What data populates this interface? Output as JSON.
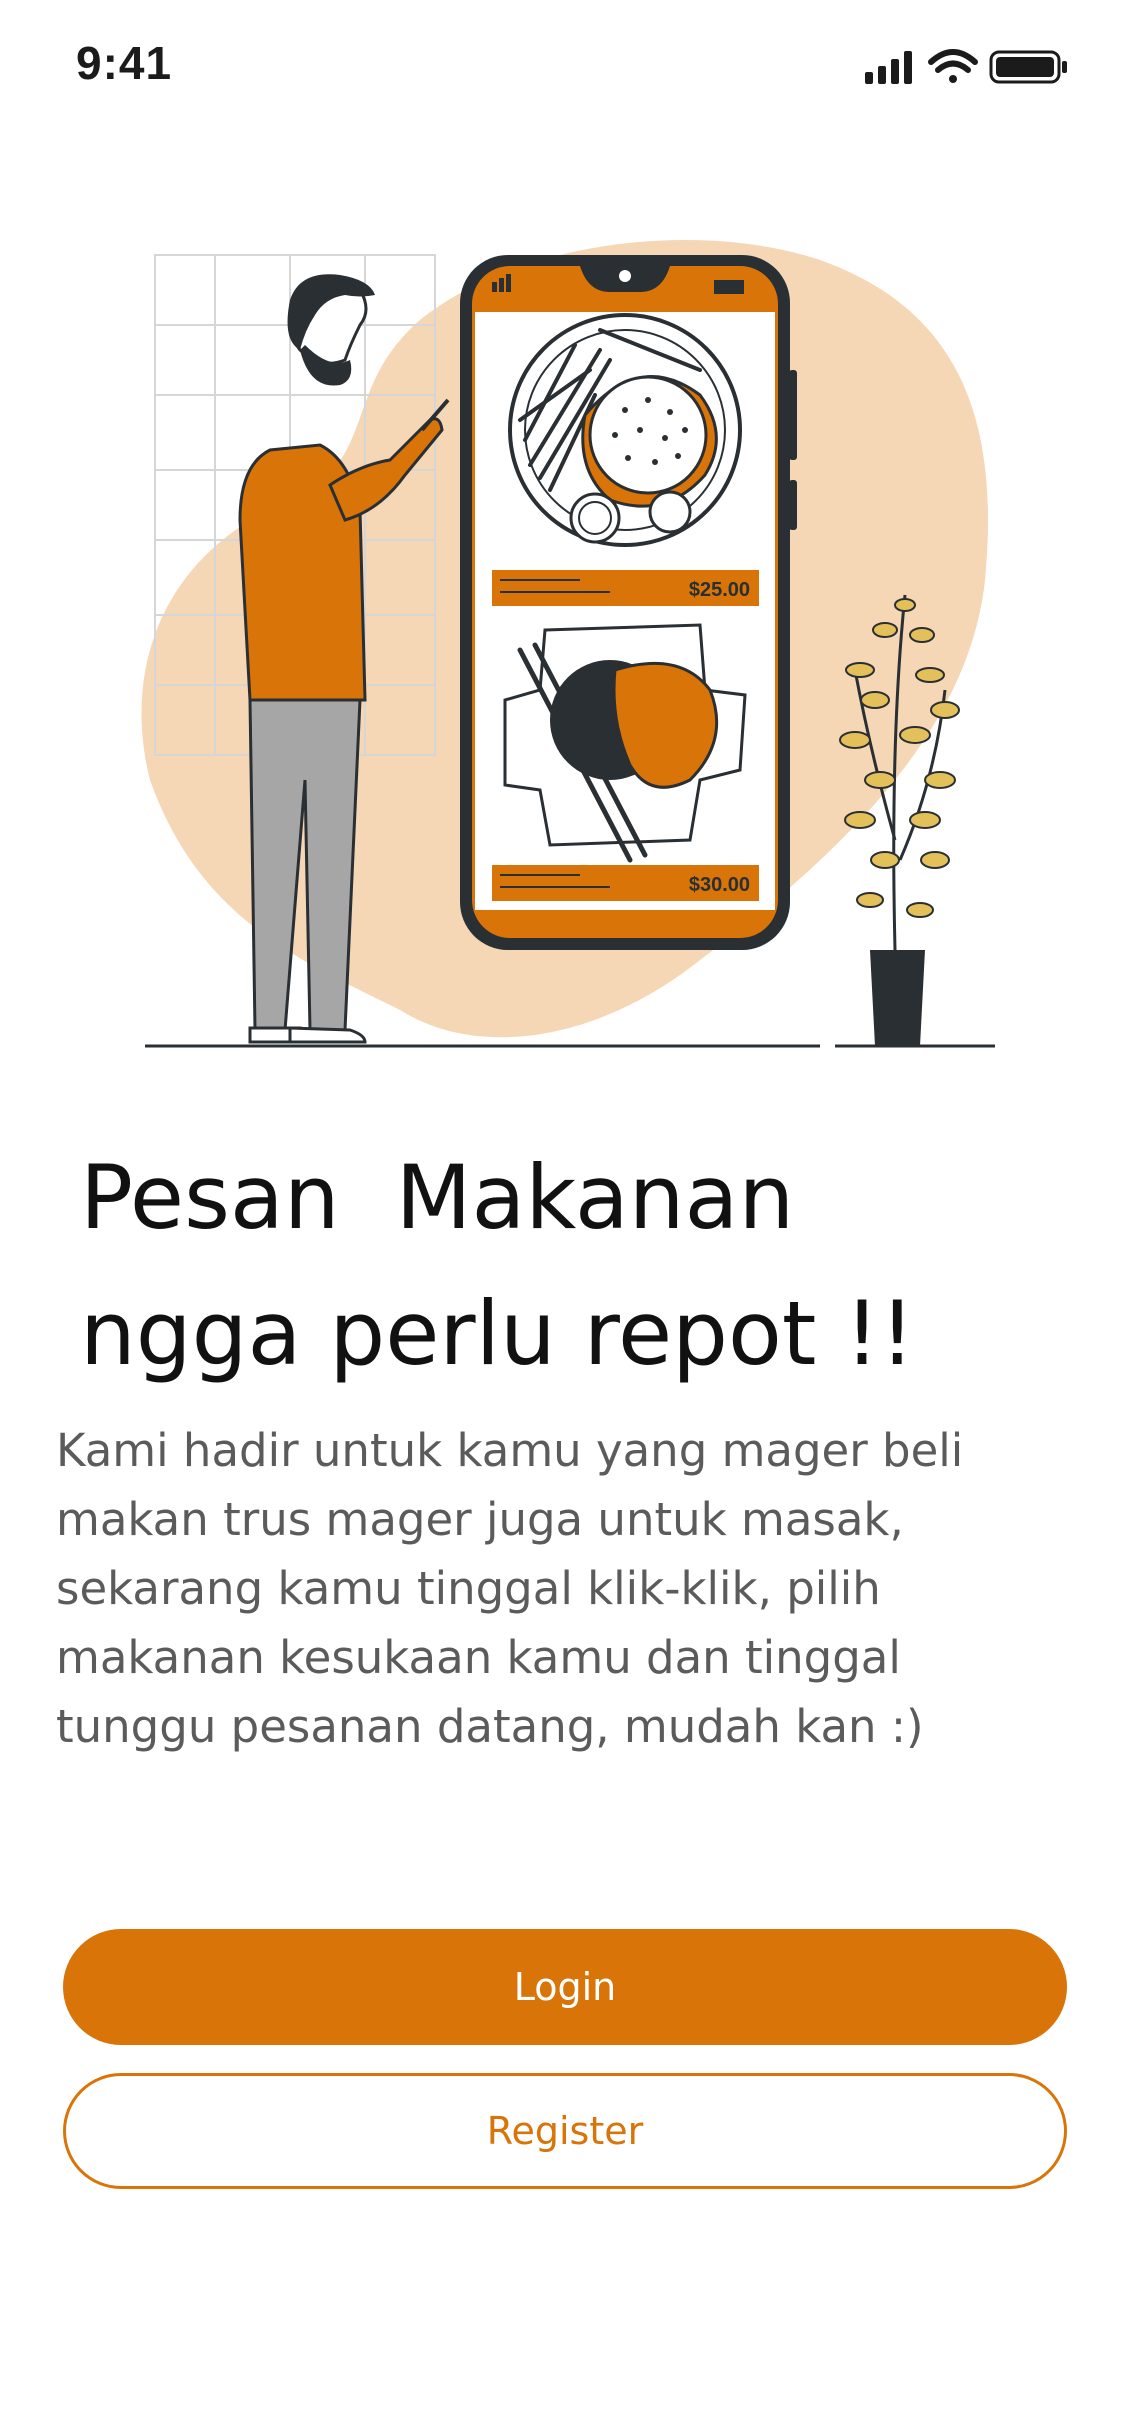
{
  "status_bar": {
    "time": "9:41",
    "icons": [
      "signal-icon",
      "wifi-icon",
      "battery-icon"
    ]
  },
  "illustration": {
    "price_top": "$25.00",
    "price_bottom": "$30.00"
  },
  "headline": {
    "line1": "Pesan  Makanan",
    "line2": "ngga perlu repot !!"
  },
  "description": "Kami hadir untuk kamu yang mager beli makan trus mager juga untuk masak, sekarang kamu tinggal klik-klik, pilih makanan kesukaan kamu dan tinggal tunggu pesanan datang, mudah kan :)",
  "buttons": {
    "login": "Login",
    "register": "Register"
  },
  "colors": {
    "accent": "#d97508",
    "blob": "#f5d6b5",
    "text_dark": "#111111",
    "text_muted": "#5b5b5b"
  }
}
